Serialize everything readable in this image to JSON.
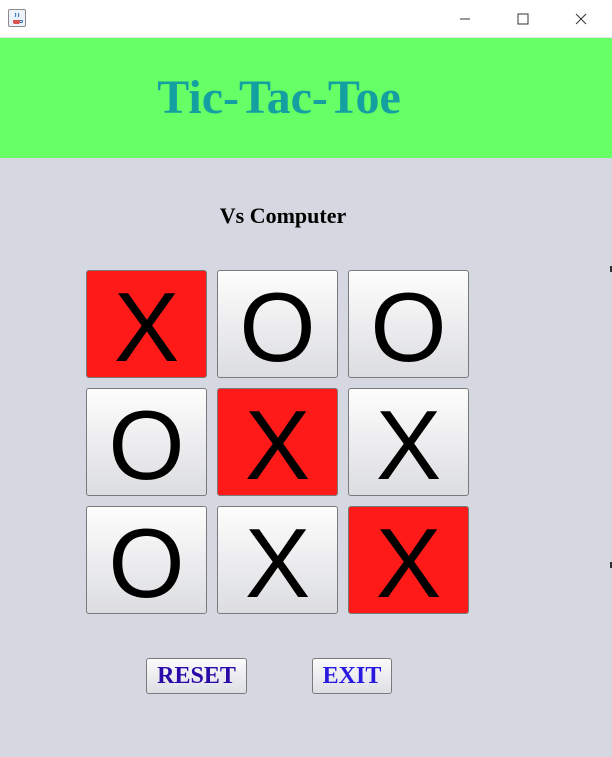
{
  "app": {
    "title": "Tic-Tac-Toe",
    "mode": "Vs Computer"
  },
  "window": {
    "icon": "java-app-icon",
    "controls": [
      "minimize-icon",
      "maximize-icon",
      "close-icon"
    ]
  },
  "board": {
    "cells": [
      {
        "mark": "X",
        "highlighted": true
      },
      {
        "mark": "O",
        "highlighted": false
      },
      {
        "mark": "O",
        "highlighted": false
      },
      {
        "mark": "O",
        "highlighted": false
      },
      {
        "mark": "X",
        "highlighted": true
      },
      {
        "mark": "X",
        "highlighted": false
      },
      {
        "mark": "O",
        "highlighted": false
      },
      {
        "mark": "X",
        "highlighted": false
      },
      {
        "mark": "X",
        "highlighted": true
      }
    ]
  },
  "buttons": {
    "reset": "RESET",
    "exit": "EXIT"
  },
  "colors": {
    "banner": "#66ff66",
    "title": "#14a0a0",
    "background": "#d5d8e1",
    "highlight": "#ff1a1a",
    "reset_text": "#2a0aa8",
    "exit_text": "#2a1ae0"
  }
}
